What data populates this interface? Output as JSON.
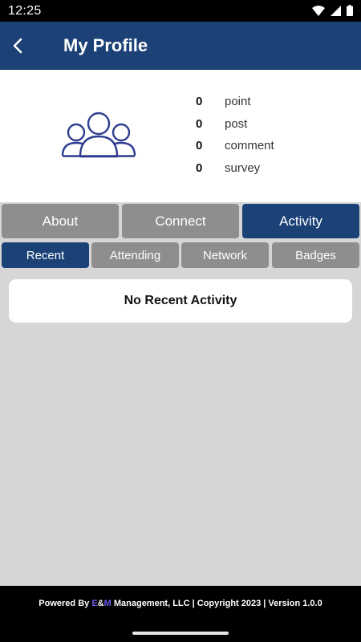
{
  "status_bar": {
    "time": "12:25",
    "icons": [
      "wifi-icon",
      "signal-icon",
      "battery-icon"
    ]
  },
  "app_bar": {
    "back_icon": "chevron-left-icon",
    "title": "My Profile"
  },
  "profile": {
    "avatar_icon": "users-group-icon",
    "stats": [
      {
        "value": "0",
        "label": "point"
      },
      {
        "value": "0",
        "label": "post"
      },
      {
        "value": "0",
        "label": "comment"
      },
      {
        "value": "0",
        "label": "survey"
      }
    ]
  },
  "tabs": [
    {
      "label": "About",
      "active": false
    },
    {
      "label": "Connect",
      "active": false
    },
    {
      "label": "Activity",
      "active": true
    }
  ],
  "subtabs": [
    {
      "label": "Recent",
      "active": true
    },
    {
      "label": "Attending",
      "active": false
    },
    {
      "label": "Network",
      "active": false
    },
    {
      "label": "Badges",
      "active": false
    }
  ],
  "content": {
    "empty_message": "No Recent Activity"
  },
  "footer": {
    "prefix": "Powered By ",
    "brand_e": "E",
    "brand_amp": "&",
    "brand_m": "M",
    "suffix": " Management, LLC | Copyright 2023 | Version 1.0.0"
  },
  "colors": {
    "primary": "#1b4177",
    "tab_inactive": "#8e8e8e",
    "background": "#d6d6d6",
    "brand_accent": "#6d5ce8"
  }
}
